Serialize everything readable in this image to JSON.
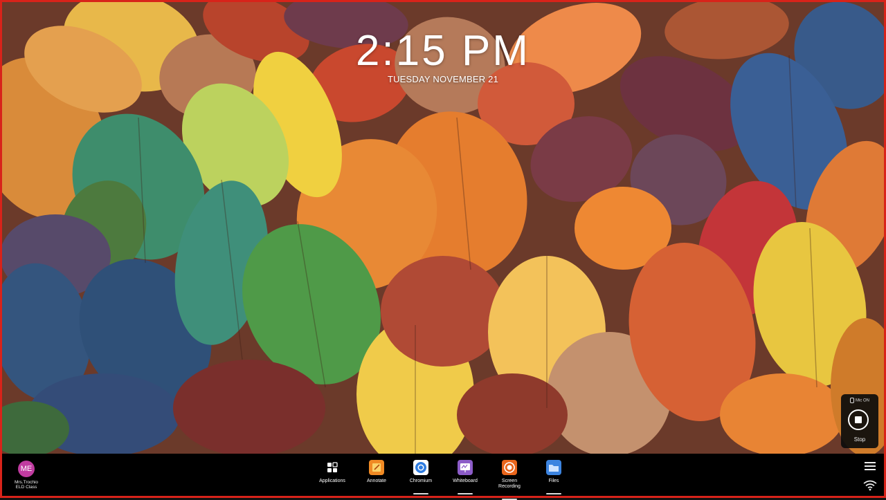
{
  "lock_screen": {
    "time": "2:15 PM",
    "date": "TUESDAY NOVEMBER 21"
  },
  "recording_widget": {
    "mic_status": "Mic ON",
    "stop_label": "Stop"
  },
  "user": {
    "initials": "ME",
    "name": "Mrs.Trochio",
    "class": "ELD Class",
    "avatar_color": "#c03ba0"
  },
  "taskbar": {
    "apps": [
      {
        "label": "Applications",
        "icon": "grid-icon",
        "active": false
      },
      {
        "label": "Annotate",
        "icon": "annotate-icon",
        "color": "#f08a24",
        "active": false
      },
      {
        "label": "Chromium",
        "icon": "chromium-icon",
        "color": "#2f7de1",
        "active": true
      },
      {
        "label": "Whiteboard",
        "icon": "whiteboard-icon",
        "color": "#8c5cc8",
        "active": true
      },
      {
        "label": "Screen\nRecording",
        "label_line1": "Screen",
        "label_line2": "Recording",
        "icon": "screen-recording-icon",
        "color": "#e9651b",
        "active": true
      },
      {
        "label": "Files",
        "icon": "folder-icon",
        "color": "#3c84e0",
        "active": true
      }
    ]
  },
  "colors": {
    "frame_border": "#d8231a",
    "taskbar_bg": "#000000"
  }
}
